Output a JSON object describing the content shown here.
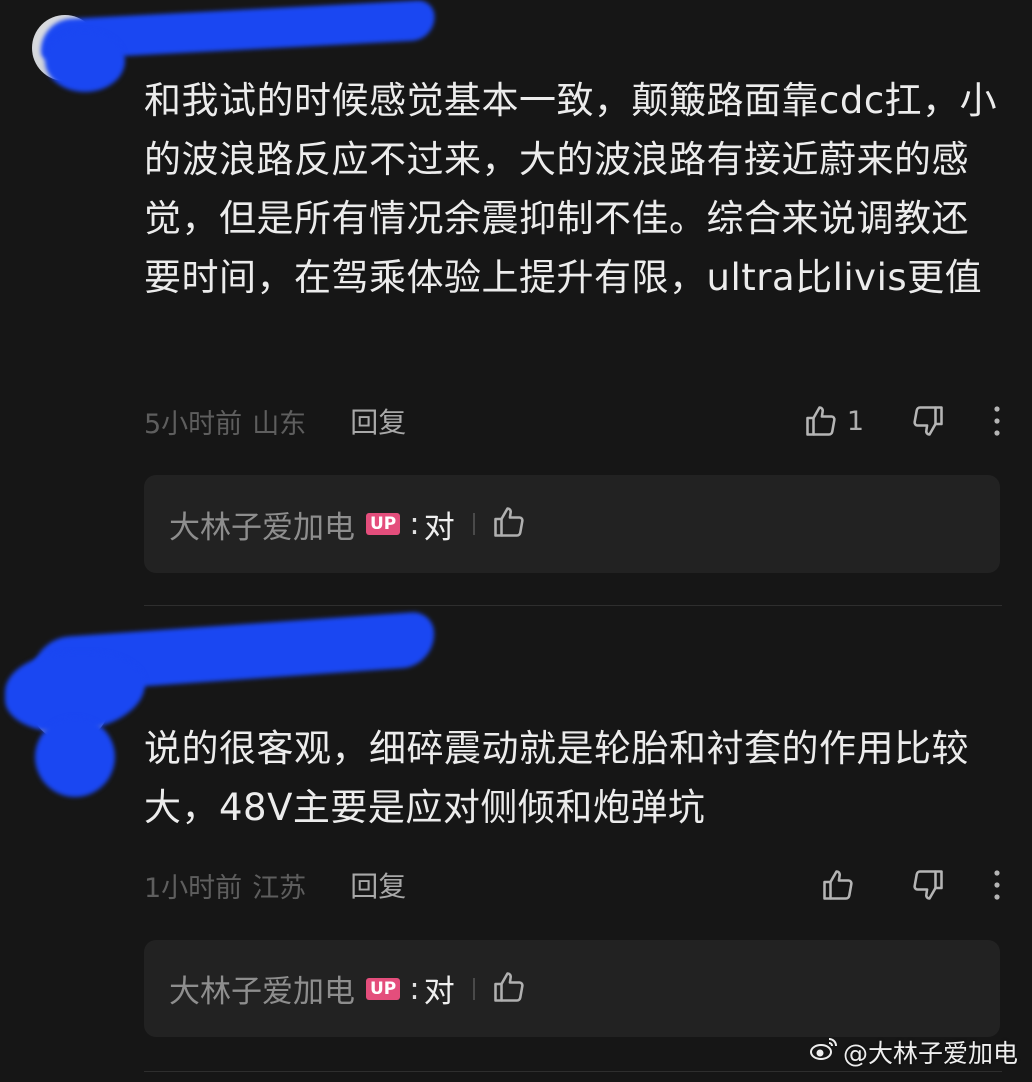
{
  "comments": [
    {
      "text": "和我试的时候感觉基本一致，颠簸路面靠cdc扛，小的波浪路反应不过来，大的波浪路有接近蔚来的感觉，但是所有情况余震抑制不佳。综合来说调教还要时间，在驾乘体验上提升有限，ultra比livis更值",
      "time": "5小时前",
      "location": "山东",
      "reply_label": "回复",
      "like_count": "1",
      "reply": {
        "author": "大林子爱加电",
        "badge": "UP",
        "separator": ":",
        "text": "对"
      }
    },
    {
      "text": "说的很客观，细碎震动就是轮胎和衬套的作用比较大，48V主要是应对侧倾和炮弹坑",
      "time": "1小时前",
      "location": "江苏",
      "reply_label": "回复",
      "like_count": "",
      "reply": {
        "author": "大林子爱加电",
        "badge": "UP",
        "separator": ":",
        "text": "对"
      }
    }
  ],
  "icons": {
    "like": "thumbs-up-icon",
    "dislike": "thumbs-down-icon",
    "more": "more-vertical-icon",
    "weibo": "weibo-logo-icon"
  },
  "colors": {
    "background": "#161616",
    "up_badge": "#e44e7c",
    "redaction": "#1a47f2"
  },
  "watermark": "@大林子爱加电"
}
